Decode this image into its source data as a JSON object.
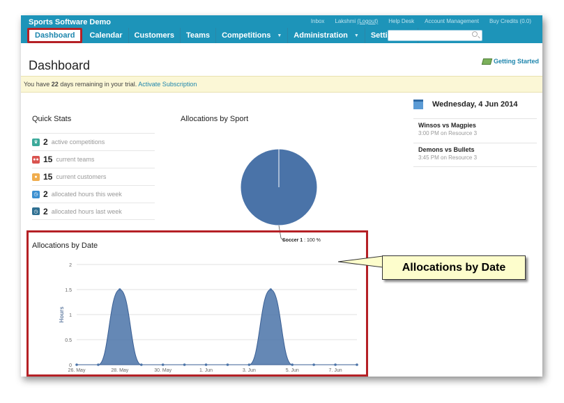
{
  "app": {
    "brand": "Sports Software Demo",
    "top_links": [
      "Inbox",
      "Lakshmi",
      "(Logout)",
      "Help Desk",
      "Account Management",
      "Buy Credits",
      "(0.0)"
    ]
  },
  "nav": {
    "items": [
      {
        "label": "Dashboard",
        "active": true,
        "caret": false
      },
      {
        "label": "Calendar",
        "active": false,
        "caret": false
      },
      {
        "label": "Customers",
        "active": false,
        "caret": false
      },
      {
        "label": "Teams",
        "active": false,
        "caret": false
      },
      {
        "label": "Competitions",
        "active": false,
        "caret": true
      },
      {
        "label": "Administration",
        "active": false,
        "caret": true
      },
      {
        "label": "Settings",
        "active": false,
        "caret": true
      }
    ],
    "search_placeholder": ""
  },
  "page": {
    "title": "Dashboard",
    "getting_started": "Getting Started",
    "trial_prefix": "You have ",
    "trial_days": "22",
    "trial_suffix": " days remaining in your trial. ",
    "trial_link": "Activate Subscription"
  },
  "quick_stats": {
    "title": "Quick Stats",
    "items": [
      {
        "value": "2",
        "label": "active competitions",
        "icon": "trophy-icon",
        "color": "#3ba99a"
      },
      {
        "value": "15",
        "label": "current teams",
        "icon": "team-icon",
        "color": "#d9534f"
      },
      {
        "value": "15",
        "label": "current customers",
        "icon": "customer-icon",
        "color": "#f0ad4e"
      },
      {
        "value": "2",
        "label": "allocated hours this week",
        "icon": "clock-icon",
        "color": "#3b8fd0"
      },
      {
        "value": "2",
        "label": "allocated hours last week",
        "icon": "clock-icon",
        "color": "#2f6f91"
      }
    ]
  },
  "allocations_by_sport": {
    "title": "Allocations by Sport",
    "label_name": "Soccer 1",
    "label_sep": " : ",
    "label_value": "100 %"
  },
  "schedule": {
    "date": "Wednesday, 4 Jun 2014",
    "events": [
      {
        "title": "Winsos vs Magpies",
        "sub": "3:00 PM on Resource 3"
      },
      {
        "title": "Demons vs Bullets",
        "sub": "3:45 PM on Resource 3"
      }
    ]
  },
  "allocations_by_date": {
    "title": "Allocations by Date",
    "callout": "Allocations by Date"
  },
  "chart_data": [
    {
      "type": "pie",
      "title": "Allocations by Sport",
      "categories": [
        "Soccer 1"
      ],
      "values": [
        100
      ],
      "colors": [
        "#4a73a8"
      ]
    },
    {
      "type": "area",
      "title": "Allocations by Date",
      "xlabel": "",
      "ylabel": "Hours",
      "ylim": [
        0,
        2
      ],
      "yticks": [
        0,
        0.5,
        1,
        1.5,
        2
      ],
      "x": [
        "26. May",
        "27. May",
        "28. May",
        "29. May",
        "30. May",
        "31. May",
        "1. Jun",
        "2. Jun",
        "3. Jun",
        "4. Jun",
        "5. Jun",
        "6. Jun",
        "7. Jun",
        "8. Jun"
      ],
      "xtick_labels": [
        "26. May",
        "28. May",
        "30. May",
        "1. Jun",
        "3. Jun",
        "5. Jun",
        "7. Jun"
      ],
      "series": [
        {
          "values": [
            0,
            0,
            1.5,
            0,
            0,
            0,
            0,
            0,
            0,
            1.5,
            0,
            0,
            0,
            0
          ]
        }
      ],
      "color": "#4a73a8",
      "grid": true
    }
  ]
}
